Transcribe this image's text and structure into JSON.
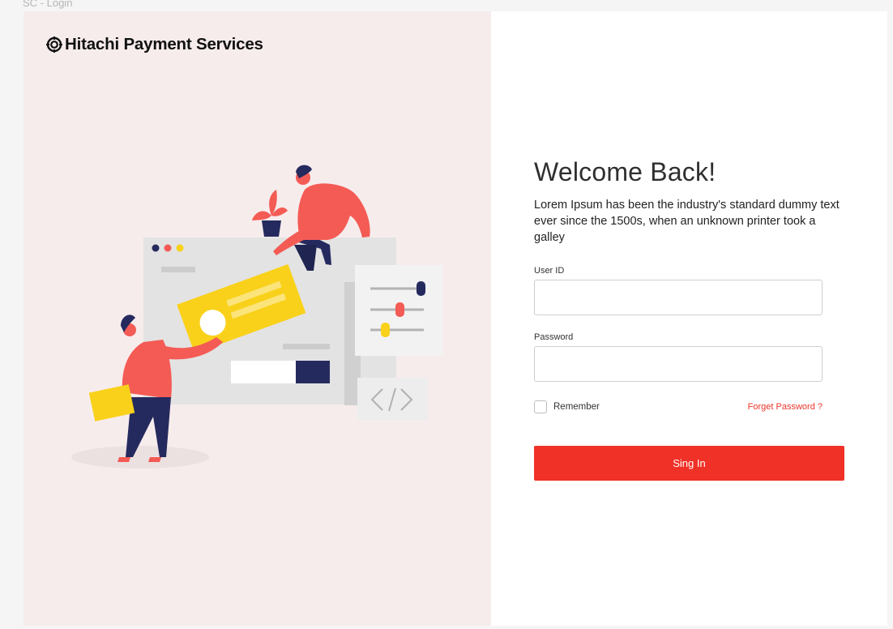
{
  "frame_label": "SC - Login",
  "brand": {
    "name": "Hitachi Payment Services",
    "icon": "hitachi-logo-icon"
  },
  "welcome": {
    "title": "Welcome Back!",
    "text": "Lorem Ipsum has been the industry's standard dummy text ever since the 1500s, when an unknown printer took a galley"
  },
  "form": {
    "user_id_label": "User ID",
    "user_id_value": "",
    "password_label": "Password",
    "password_value": "",
    "remember_label": "Remember",
    "remember_checked": false,
    "forgot_label": "Forget Password ?",
    "signin_label": "Sing In"
  },
  "colors": {
    "accent": "#f03127",
    "panel_bg": "#f7ecec",
    "illustration_red": "#f45b55",
    "illustration_yellow": "#f9d11a",
    "illustration_navy": "#252a5e"
  }
}
